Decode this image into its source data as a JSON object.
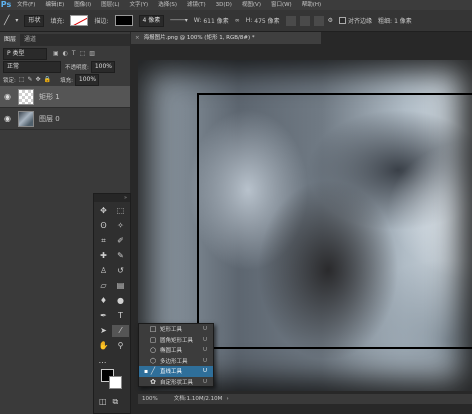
{
  "app": {
    "logo": "Ps"
  },
  "menu": [
    "文件(F)",
    "编辑(E)",
    "图像(I)",
    "图层(L)",
    "文字(Y)",
    "选择(S)",
    "滤镜(T)",
    "3D(D)",
    "视图(V)",
    "窗口(W)",
    "帮助(H)"
  ],
  "options": {
    "mode": "形状",
    "fill_label": "填充:",
    "stroke_label": "描边:",
    "stroke_width": "4 像素",
    "w_label": "W:",
    "w_value": "611 像素",
    "h_label": "H:",
    "h_value": "475 像素",
    "align_label": "对齐边缘",
    "weight_label": "粗细:",
    "weight_value": "1 像素"
  },
  "panels": {
    "tabs": [
      "图层",
      "通道"
    ],
    "kind_filter": "P 类型",
    "blend_mode": "正常",
    "opacity_label": "不透明度:",
    "opacity_value": "100%",
    "lock_label": "锁定:",
    "fill_label": "填充:",
    "fill_value": "100%",
    "layers": [
      {
        "name": "矩形 1",
        "selected": true,
        "thumb": "transparent"
      },
      {
        "name": "图层 0",
        "selected": false,
        "thumb": "photo"
      }
    ]
  },
  "document": {
    "tab_title": "海报图片.png @ 100% (矩形 1, RGB/8#) *",
    "zoom": "100%",
    "doc_info": "文档:1.10M/2.10M"
  },
  "tools": [
    {
      "name": "move-tool",
      "glyph": "✥"
    },
    {
      "name": "marquee-tool",
      "glyph": "⬚"
    },
    {
      "name": "lasso-tool",
      "glyph": "ʘ"
    },
    {
      "name": "magic-wand-tool",
      "glyph": "✧"
    },
    {
      "name": "crop-tool",
      "glyph": "⌗"
    },
    {
      "name": "eyedropper-tool",
      "glyph": "✐"
    },
    {
      "name": "healing-brush-tool",
      "glyph": "✚"
    },
    {
      "name": "brush-tool",
      "glyph": "✎"
    },
    {
      "name": "clone-stamp-tool",
      "glyph": "♙"
    },
    {
      "name": "history-brush-tool",
      "glyph": "↺"
    },
    {
      "name": "eraser-tool",
      "glyph": "▱"
    },
    {
      "name": "gradient-tool",
      "glyph": "▤"
    },
    {
      "name": "blur-tool",
      "glyph": "♦"
    },
    {
      "name": "dodge-tool",
      "glyph": "●"
    },
    {
      "name": "pen-tool",
      "glyph": "✒"
    },
    {
      "name": "type-tool",
      "glyph": "T"
    },
    {
      "name": "path-selection-tool",
      "glyph": "➤"
    },
    {
      "name": "line-tool",
      "glyph": "⁄"
    },
    {
      "name": "hand-tool",
      "glyph": "✋"
    },
    {
      "name": "zoom-tool",
      "glyph": "⚲"
    }
  ],
  "more_tools": "…",
  "flyout": [
    {
      "label": "矩形工具",
      "key": "U",
      "icon": "□",
      "current": false
    },
    {
      "label": "圆角矩形工具",
      "key": "U",
      "icon": "▢",
      "current": false
    },
    {
      "label": "椭圆工具",
      "key": "U",
      "icon": "○",
      "current": false
    },
    {
      "label": "多边形工具",
      "key": "U",
      "icon": "⬡",
      "current": false
    },
    {
      "label": "直线工具",
      "key": "U",
      "icon": "╱",
      "current": true
    },
    {
      "label": "自定形状工具",
      "key": "U",
      "icon": "✿",
      "current": false
    }
  ]
}
